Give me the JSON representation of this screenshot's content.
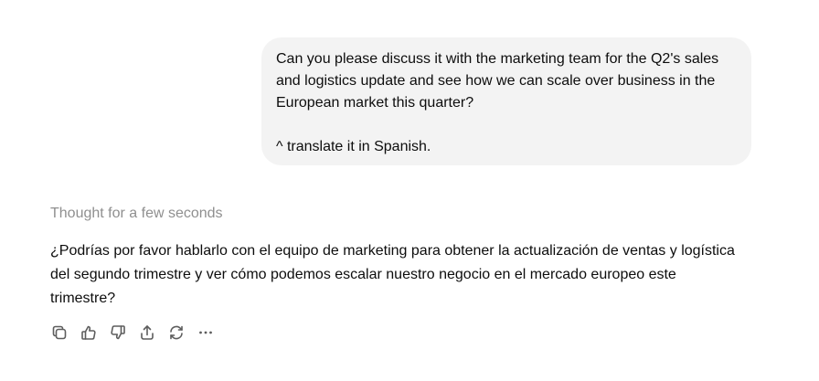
{
  "conversation": {
    "user_message": {
      "lines": [
        "Can you please discuss it with the marketing team for the Q2's sales",
        "and logistics update and see how we can scale over business in the",
        "European market this quarter?",
        "^ translate it in Spanish."
      ]
    },
    "assistant": {
      "thought_label": "Thought for a few seconds",
      "reply_lines": [
        "¿Podrías por favor hablarlo con el equipo de marketing para obtener la actualización de ventas y logística",
        "del segundo trimestre y ver cómo podemos escalar nuestro negocio en el mercado europeo este",
        "trimestre?"
      ]
    }
  },
  "actions": {
    "icons": [
      "copy-icon",
      "thumbs-up-icon",
      "thumbs-down-icon",
      "share-icon",
      "regenerate-icon",
      "more-icon"
    ]
  },
  "colors": {
    "user_bubble_bg": "#f3f3f3",
    "muted_text": "#8f8f8f",
    "text": "#0d0d0d",
    "icon": "#5d5d5d"
  }
}
